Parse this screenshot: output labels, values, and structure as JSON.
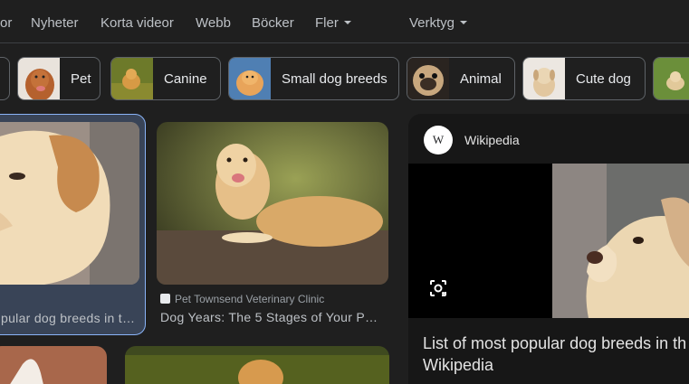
{
  "nav": {
    "partial_tab": "or",
    "tabs": [
      "Nyheter",
      "Korta videor",
      "Webb",
      "Böcker"
    ],
    "more_label": "Fler",
    "tools_label": "Verktyg"
  },
  "chips": [
    {
      "label": ""
    },
    {
      "label": "Pet"
    },
    {
      "label": "Canine"
    },
    {
      "label": "Small dog breeds"
    },
    {
      "label": "Animal"
    },
    {
      "label": "Cute dog"
    },
    {
      "label": ""
    }
  ],
  "results": [
    {
      "caption": "pular dog breeds in t…"
    },
    {
      "source": "Pet Townsend Veterinary Clinic",
      "caption": "Dog Years: The 5 Stages of Your P…"
    }
  ],
  "panel": {
    "logo_letter": "W",
    "source_name": "Wikipedia",
    "title_line1": "List of most popular dog breeds in th",
    "title_line2": "Wikipedia"
  },
  "icons": {
    "lens": "google-lens-icon",
    "favicon": "site-favicon-icon",
    "wikipedia": "wikipedia-logo-icon"
  },
  "colors": {
    "background": "#1f1f1f",
    "selected_card": "#394457",
    "selected_border": "#8ab4f8",
    "panel_bg": "#171717"
  }
}
